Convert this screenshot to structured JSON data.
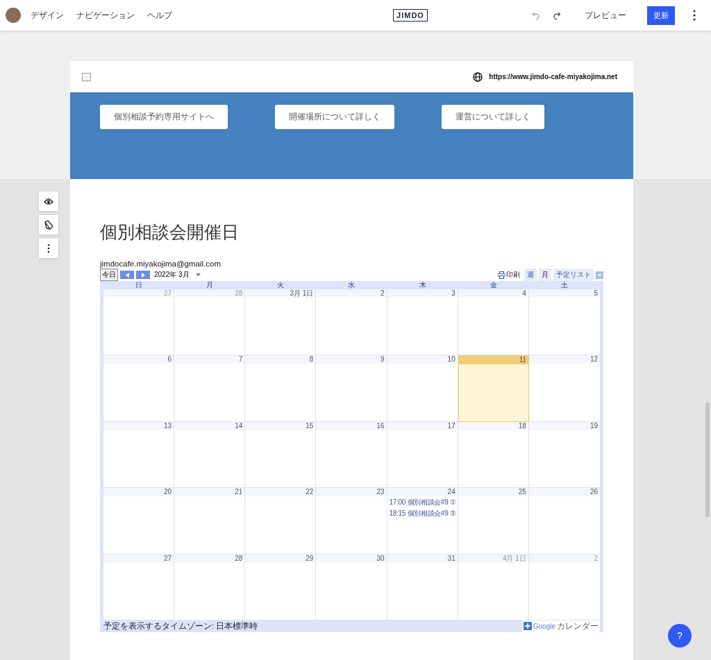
{
  "topbar": {
    "menu": [
      "デザイン",
      "ナビゲーション",
      "ヘルプ"
    ],
    "logo": "JIMDO",
    "preview": "プレビュー",
    "publish": "更新"
  },
  "site_header": {
    "url": "https://www.jimdo-cafe-miyakojima.net"
  },
  "banner_buttons": [
    "個別相談予約専用サイトへ",
    "開催場所について詳しく",
    "運営について詳しく"
  ],
  "section_title": "個別相談会開催日",
  "calendar": {
    "account": "jimdocafe.miyakojima@gmail.com",
    "today_button": "今日",
    "month": "2022年 3月",
    "print": "印刷",
    "views": [
      {
        "label": "週",
        "selected": false
      },
      {
        "label": "月",
        "selected": true
      },
      {
        "label": "予定リスト",
        "selected": false
      }
    ],
    "weekdays": [
      "日",
      "月",
      "火",
      "水",
      "木",
      "金",
      "土"
    ],
    "weeks": [
      [
        {
          "label": "27",
          "other_month": true,
          "today": false
        },
        {
          "label": "28",
          "other_month": true,
          "today": false
        },
        {
          "label": "3月 1日",
          "other_month": false,
          "today": false
        },
        {
          "label": "2",
          "other_month": false,
          "today": false
        },
        {
          "label": "3",
          "other_month": false,
          "today": false
        },
        {
          "label": "4",
          "other_month": false,
          "today": false
        },
        {
          "label": "5",
          "other_month": false,
          "today": false
        }
      ],
      [
        {
          "label": "6",
          "other_month": false,
          "today": false
        },
        {
          "label": "7",
          "other_month": false,
          "today": false
        },
        {
          "label": "8",
          "other_month": false,
          "today": false
        },
        {
          "label": "9",
          "other_month": false,
          "today": false
        },
        {
          "label": "10",
          "other_month": false,
          "today": false
        },
        {
          "label": "11",
          "other_month": false,
          "today": true
        },
        {
          "label": "12",
          "other_month": false,
          "today": false
        }
      ],
      [
        {
          "label": "13",
          "other_month": false,
          "today": false
        },
        {
          "label": "14",
          "other_month": false,
          "today": false
        },
        {
          "label": "15",
          "other_month": false,
          "today": false
        },
        {
          "label": "16",
          "other_month": false,
          "today": false
        },
        {
          "label": "17",
          "other_month": false,
          "today": false
        },
        {
          "label": "18",
          "other_month": false,
          "today": false
        },
        {
          "label": "19",
          "other_month": false,
          "today": false
        }
      ],
      [
        {
          "label": "20",
          "other_month": false,
          "today": false
        },
        {
          "label": "21",
          "other_month": false,
          "today": false
        },
        {
          "label": "22",
          "other_month": false,
          "today": false
        },
        {
          "label": "23",
          "other_month": false,
          "today": false
        },
        {
          "label": "24",
          "other_month": false,
          "today": false,
          "events": [
            {
              "time": "17:00",
              "title": "個別相談会#9 ①"
            },
            {
              "time": "18:15",
              "title": "個別相談会#9 ②"
            }
          ]
        },
        {
          "label": "25",
          "other_month": false,
          "today": false
        },
        {
          "label": "26",
          "other_month": false,
          "today": false
        }
      ],
      [
        {
          "label": "27",
          "other_month": false,
          "today": false
        },
        {
          "label": "28",
          "other_month": false,
          "today": false
        },
        {
          "label": "29",
          "other_month": false,
          "today": false
        },
        {
          "label": "30",
          "other_month": false,
          "today": false
        },
        {
          "label": "31",
          "other_month": false,
          "today": false
        },
        {
          "label": "4月 1日",
          "other_month": true,
          "today": false
        },
        {
          "label": "2",
          "other_month": true,
          "today": false
        }
      ]
    ],
    "timezone": "予定を表示するタイムゾーン: 日本標準時",
    "google_brand": "Google",
    "google_product": "カレンダー"
  },
  "help_button": "?"
}
